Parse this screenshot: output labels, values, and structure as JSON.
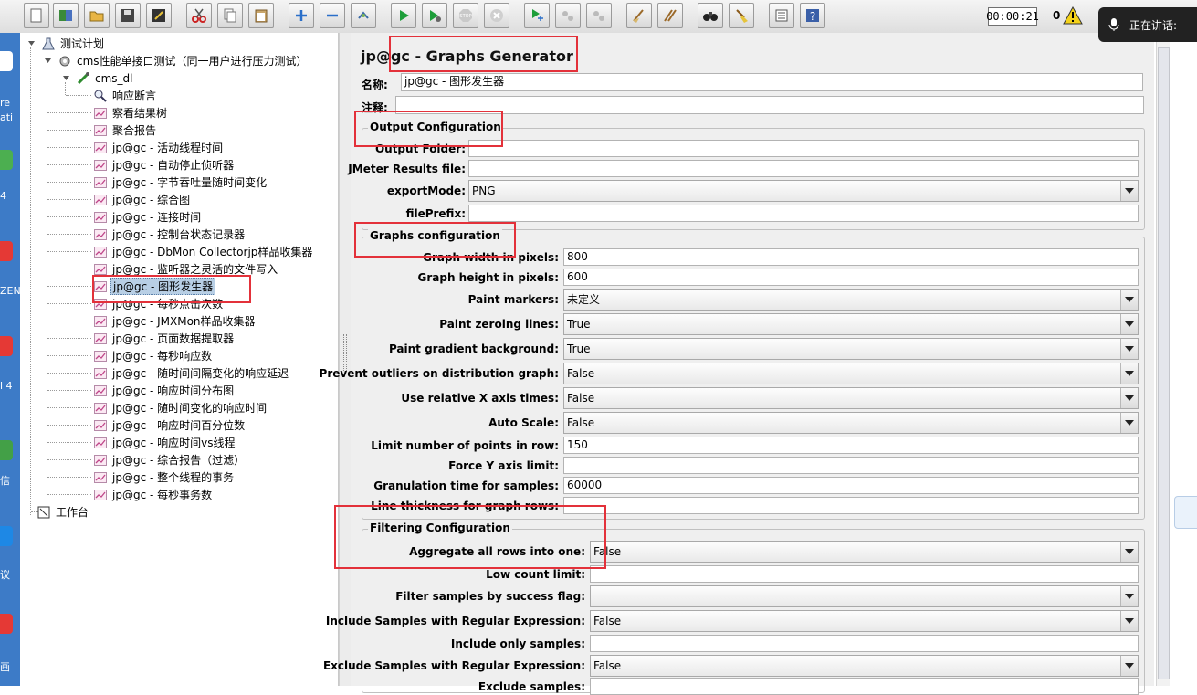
{
  "toolbar": {
    "timer": "00:00:21",
    "active_count": "0",
    "speaking_label": "正在讲话:",
    "stop_label": "STOP"
  },
  "desktop_fragments": [
    "re",
    "ati",
    "4",
    "ZEN",
    "l 4",
    "信",
    "议",
    "画"
  ],
  "tree": {
    "root": "测试计划",
    "thread_group": "cms性能单接口测试（同一用户进行压力测试）",
    "sampler": "cms_dl",
    "assertion": "响应断言",
    "listeners": [
      "察看结果树",
      "聚合报告",
      "jp@gc - 活动线程时间",
      "jp@gc - 自动停止侦听器",
      "jp@gc - 字节吞吐量随时间变化",
      "jp@gc - 综合图",
      "jp@gc - 连接时间",
      "jp@gc - 控制台状态记录器",
      "jp@gc - DbMon Collectorjp样品收集器",
      "jp@gc - 监听器之灵活的文件写入",
      "jp@gc - 图形发生器",
      "jp@gc - 每秒点击次数",
      "jp@gc - JMXMon样品收集器",
      "jp@gc - 页面数据提取器",
      "jp@gc - 每秒响应数",
      "jp@gc - 随时间间隔变化的响应延迟",
      "jp@gc - 响应时间分布图",
      "jp@gc - 随时间变化的响应时间",
      "jp@gc - 响应时间百分位数",
      "jp@gc - 响应时间vs线程",
      "jp@gc - 综合报告（过滤）",
      "jp@gc - 整个线程的事务",
      "jp@gc - 每秒事务数"
    ],
    "selected_index": 10,
    "workbench": "工作台"
  },
  "panel": {
    "title": "jp@gc - Graphs Generator",
    "name_label": "名称:",
    "name_value": "jp@gc - 图形发生器",
    "comment_label": "注释:",
    "comment_value": "",
    "output": {
      "legend": "Output Configuration",
      "output_folder_label": "Output Folder:",
      "output_folder_value": "",
      "results_file_label": "JMeter Results file:",
      "results_file_value": "",
      "export_mode_label": "exportMode:",
      "export_mode_value": "PNG",
      "file_prefix_label": "filePrefix:",
      "file_prefix_value": ""
    },
    "graphs": {
      "legend": "Graphs configuration",
      "width_label": "Graph width in pixels:",
      "width_value": "800",
      "height_label": "Graph height in pixels:",
      "height_value": "600",
      "paint_markers_label": "Paint markers:",
      "paint_markers_value": "未定义",
      "paint_zeroing_label": "Paint zeroing lines:",
      "paint_zeroing_value": "True",
      "paint_gradient_label": "Paint gradient background:",
      "paint_gradient_value": "True",
      "prevent_outliers_label": "Prevent outliers on distribution graph:",
      "prevent_outliers_value": "False",
      "relative_x_label": "Use relative X axis times:",
      "relative_x_value": "False",
      "auto_scale_label": "Auto Scale:",
      "auto_scale_value": "False",
      "limit_points_label": "Limit number of points in row:",
      "limit_points_value": "150",
      "force_y_label": "Force Y axis limit:",
      "force_y_value": "",
      "granulation_label": "Granulation time for samples:",
      "granulation_value": "60000",
      "line_thickness_label": "Line thickness for graph rows:",
      "line_thickness_value": ""
    },
    "filtering": {
      "legend": "Filtering Configuration",
      "aggregate_label": "Aggregate all rows into one:",
      "aggregate_value": "False",
      "low_count_label": "Low count limit:",
      "low_count_value": "",
      "success_flag_label": "Filter samples by success flag:",
      "success_flag_value": "",
      "include_regex_label": "Include Samples with Regular Expression:",
      "include_regex_value": "False",
      "include_only_label": "Include only samples:",
      "include_only_value": "",
      "exclude_regex_label": "Exclude Samples with Regular Expression:",
      "exclude_regex_value": "False",
      "exclude_samples_label": "Exclude samples:"
    }
  },
  "colors": {
    "highlight": "#e3313a",
    "selection": "#b8cfe5",
    "panel_bg": "#efefef"
  }
}
